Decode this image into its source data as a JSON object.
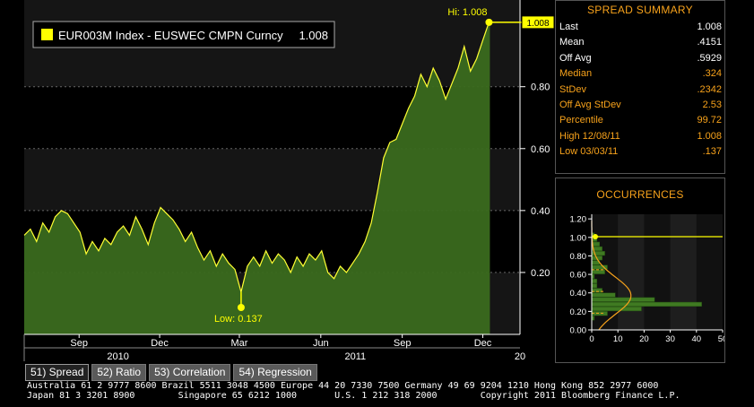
{
  "chart_data": {
    "type": "area",
    "legend_label": "EUR003M Index - EUSWEC CMPN Curncy",
    "legend_value": "1.008",
    "last_value_tag": "1.008",
    "ylim": [
      0.0,
      1.08
    ],
    "yticks": [
      0.2,
      0.4,
      0.6,
      0.8
    ],
    "ytick_labels": [
      "0.20",
      "0.40",
      "0.60",
      "0.80"
    ],
    "xticks": [
      {
        "date": "2010-09-01",
        "label": "Sep"
      },
      {
        "date": "2010-12-01",
        "label": "Dec"
      },
      {
        "date": "2011-03-01",
        "label": "Mar"
      },
      {
        "date": "2011-06-01",
        "label": "Jun"
      },
      {
        "date": "2011-09-01",
        "label": "Sep"
      },
      {
        "date": "2011-12-01",
        "label": "Dec"
      }
    ],
    "year_labels": [
      {
        "date": "2010-10-15",
        "label": "2010"
      },
      {
        "date": "2011-07-10",
        "label": "2011"
      },
      {
        "date": "2012-01-12",
        "label": "20"
      }
    ],
    "x_start": "2010-07-01",
    "x_end": "2012-01-12",
    "high": {
      "date": "2011-12-08",
      "value": 1.008,
      "label": "Hi: 1.008"
    },
    "low": {
      "date": "2011-03-03",
      "value": 0.137,
      "label": "Low: 0.137"
    },
    "series": [
      {
        "points": [
          [
            "2010-07-01",
            0.32
          ],
          [
            "2010-07-08",
            0.34
          ],
          [
            "2010-07-15",
            0.3
          ],
          [
            "2010-07-22",
            0.36
          ],
          [
            "2010-07-29",
            0.33
          ],
          [
            "2010-08-05",
            0.38
          ],
          [
            "2010-08-12",
            0.4
          ],
          [
            "2010-08-19",
            0.39
          ],
          [
            "2010-08-26",
            0.36
          ],
          [
            "2010-09-02",
            0.33
          ],
          [
            "2010-09-09",
            0.26
          ],
          [
            "2010-09-16",
            0.3
          ],
          [
            "2010-09-23",
            0.27
          ],
          [
            "2010-09-30",
            0.31
          ],
          [
            "2010-10-07",
            0.29
          ],
          [
            "2010-10-14",
            0.33
          ],
          [
            "2010-10-21",
            0.35
          ],
          [
            "2010-10-28",
            0.32
          ],
          [
            "2010-11-04",
            0.38
          ],
          [
            "2010-11-11",
            0.34
          ],
          [
            "2010-11-18",
            0.29
          ],
          [
            "2010-11-25",
            0.36
          ],
          [
            "2010-12-02",
            0.41
          ],
          [
            "2010-12-09",
            0.39
          ],
          [
            "2010-12-16",
            0.37
          ],
          [
            "2010-12-23",
            0.34
          ],
          [
            "2010-12-30",
            0.3
          ],
          [
            "2011-01-06",
            0.33
          ],
          [
            "2011-01-13",
            0.28
          ],
          [
            "2011-01-20",
            0.24
          ],
          [
            "2011-01-27",
            0.27
          ],
          [
            "2011-02-03",
            0.22
          ],
          [
            "2011-02-10",
            0.26
          ],
          [
            "2011-02-17",
            0.23
          ],
          [
            "2011-02-24",
            0.21
          ],
          [
            "2011-03-03",
            0.137
          ],
          [
            "2011-03-10",
            0.22
          ],
          [
            "2011-03-17",
            0.25
          ],
          [
            "2011-03-24",
            0.22
          ],
          [
            "2011-03-31",
            0.27
          ],
          [
            "2011-04-07",
            0.23
          ],
          [
            "2011-04-14",
            0.26
          ],
          [
            "2011-04-21",
            0.24
          ],
          [
            "2011-04-28",
            0.2
          ],
          [
            "2011-05-05",
            0.25
          ],
          [
            "2011-05-12",
            0.22
          ],
          [
            "2011-05-19",
            0.26
          ],
          [
            "2011-05-26",
            0.24
          ],
          [
            "2011-06-02",
            0.27
          ],
          [
            "2011-06-09",
            0.2
          ],
          [
            "2011-06-16",
            0.18
          ],
          [
            "2011-06-23",
            0.22
          ],
          [
            "2011-06-30",
            0.2
          ],
          [
            "2011-07-07",
            0.23
          ],
          [
            "2011-07-14",
            0.26
          ],
          [
            "2011-07-21",
            0.3
          ],
          [
            "2011-07-28",
            0.36
          ],
          [
            "2011-08-04",
            0.46
          ],
          [
            "2011-08-11",
            0.57
          ],
          [
            "2011-08-18",
            0.62
          ],
          [
            "2011-08-25",
            0.63
          ],
          [
            "2011-09-01",
            0.68
          ],
          [
            "2011-09-08",
            0.73
          ],
          [
            "2011-09-15",
            0.77
          ],
          [
            "2011-09-22",
            0.84
          ],
          [
            "2011-09-29",
            0.8
          ],
          [
            "2011-10-06",
            0.86
          ],
          [
            "2011-10-13",
            0.82
          ],
          [
            "2011-10-20",
            0.76
          ],
          [
            "2011-10-27",
            0.81
          ],
          [
            "2011-11-03",
            0.86
          ],
          [
            "2011-11-10",
            0.93
          ],
          [
            "2011-11-17",
            0.85
          ],
          [
            "2011-11-24",
            0.89
          ],
          [
            "2011-12-01",
            0.95
          ],
          [
            "2011-12-08",
            1.008
          ],
          [
            "2011-12-09",
            1.008
          ]
        ]
      }
    ]
  },
  "summary": {
    "title": "SPREAD SUMMARY",
    "rows": [
      {
        "label": "Last",
        "value": "1.008",
        "color": "white"
      },
      {
        "label": "Mean",
        "value": ".4151",
        "color": "white"
      },
      {
        "label": "Off Avg",
        "value": ".5929",
        "color": "white"
      },
      {
        "label": "Median",
        "value": ".324",
        "color": "orange"
      },
      {
        "label": "StDev",
        "value": ".2342",
        "color": "orange"
      },
      {
        "label": "Off Avg StDev",
        "value": "2.53",
        "color": "orange"
      },
      {
        "label": "Percentile",
        "value": "99.72",
        "color": "orange"
      },
      {
        "label": "High 12/08/11",
        "value": "1.008",
        "color": "orange"
      },
      {
        "label": "Low 03/03/11",
        "value": ".137",
        "color": "orange"
      }
    ]
  },
  "occurrences": {
    "title": "OCCURRENCES",
    "type": "bar",
    "orientation": "horizontal",
    "ylim": [
      0.0,
      1.25
    ],
    "xlim": [
      0,
      50
    ],
    "yticks": [
      0.0,
      0.2,
      0.4,
      0.6,
      0.8,
      1.0,
      1.2
    ],
    "ytick_labels": [
      "0.00",
      "0.20",
      "0.40",
      "0.60",
      "0.80",
      "1.00",
      "1.20"
    ],
    "xticks": [
      0,
      10,
      20,
      30,
      40,
      50
    ],
    "bins": [
      {
        "lo": 0.1,
        "hi": 0.15,
        "count": 1
      },
      {
        "lo": 0.15,
        "hi": 0.2,
        "count": 6
      },
      {
        "lo": 0.2,
        "hi": 0.25,
        "count": 19
      },
      {
        "lo": 0.25,
        "hi": 0.3,
        "count": 42
      },
      {
        "lo": 0.3,
        "hi": 0.35,
        "count": 24
      },
      {
        "lo": 0.35,
        "hi": 0.4,
        "count": 9
      },
      {
        "lo": 0.4,
        "hi": 0.45,
        "count": 4
      },
      {
        "lo": 0.45,
        "hi": 0.5,
        "count": 2
      },
      {
        "lo": 0.5,
        "hi": 0.55,
        "count": 2
      },
      {
        "lo": 0.55,
        "hi": 0.6,
        "count": 1
      },
      {
        "lo": 0.6,
        "hi": 0.65,
        "count": 5
      },
      {
        "lo": 0.65,
        "hi": 0.7,
        "count": 6
      },
      {
        "lo": 0.7,
        "hi": 0.75,
        "count": 3
      },
      {
        "lo": 0.75,
        "hi": 0.8,
        "count": 4
      },
      {
        "lo": 0.8,
        "hi": 0.85,
        "count": 5
      },
      {
        "lo": 0.85,
        "hi": 0.9,
        "count": 4
      },
      {
        "lo": 0.9,
        "hi": 0.95,
        "count": 3
      },
      {
        "lo": 0.95,
        "hi": 1.0,
        "count": 2
      },
      {
        "lo": 1.0,
        "hi": 1.05,
        "count": 1
      }
    ],
    "markers": [
      0.415,
      0.18,
      0.65
    ],
    "current_value": 1.008
  },
  "tabs": [
    {
      "label": "51) Spread",
      "active": true
    },
    {
      "label": "52) Ratio",
      "active": false
    },
    {
      "label": "53) Correlation",
      "active": false
    },
    {
      "label": "54) Regression",
      "active": false
    }
  ],
  "footer": {
    "line1": "Australia 61 2 9777 8600 Brazil 5511 3048 4500 Europe 44 20 7330 7500 Germany 49 69 9204 1210 Hong Kong 852 2977 6000",
    "line2": "Japan 81 3 3201 8900        Singapore 65 6212 1000       U.S. 1 212 318 2000        Copyright 2011 Bloomberg Finance L.P."
  },
  "colors": {
    "line": "#ffff33",
    "fill": "#3a6a1e",
    "highlight": "#ffff00",
    "orange": "#f7a21b",
    "grid": "#666666"
  }
}
